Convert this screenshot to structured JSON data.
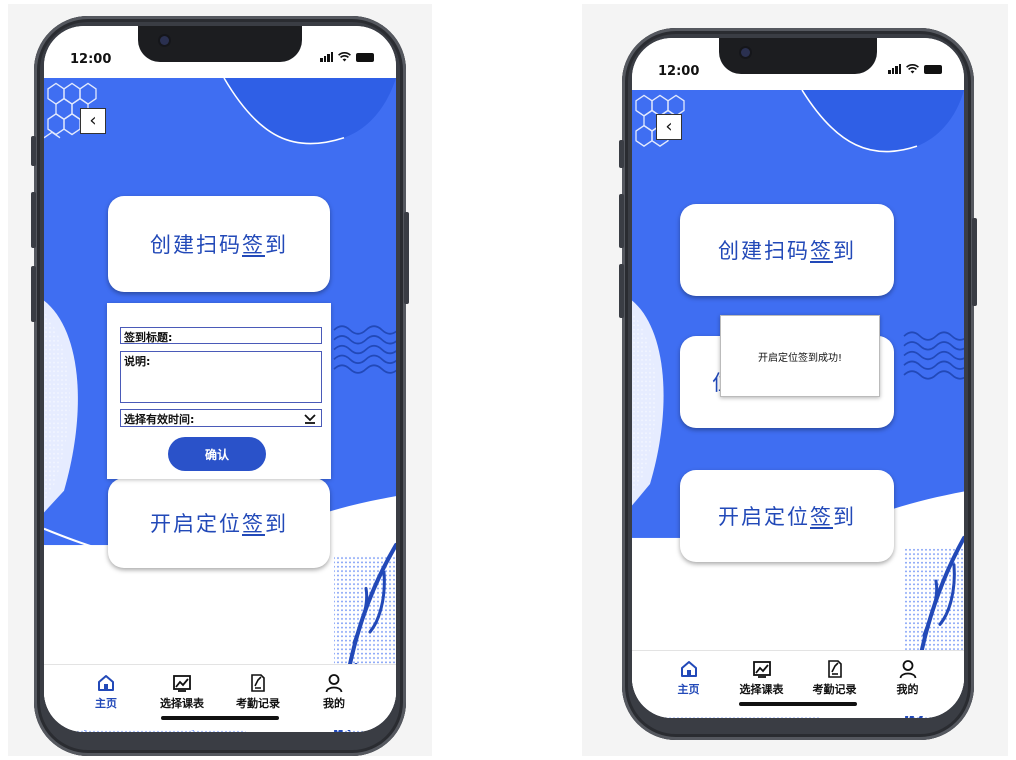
{
  "colors": {
    "accent": "#2249b8",
    "background_blue": "#3f6ef2",
    "button_blue": "#2a52c9"
  },
  "status_bar": {
    "time": "12:00"
  },
  "cards": {
    "create_qr_signin": "创建扫码签到",
    "create_qr_signin_prefix": "创建扫码",
    "location_signin_prefix": "开启定位",
    "signin_suffix_a": "签",
    "signin_suffix_b": "到"
  },
  "form": {
    "title_label": "签到标题:",
    "desc_label": "说明:",
    "time_label": "选择有效时间:",
    "confirm_label": "确认"
  },
  "toast": {
    "message": "开启定位签到成功!"
  },
  "card_partial_text": "位",
  "tabs": [
    {
      "label": "主页",
      "icon": "home-icon",
      "active": true
    },
    {
      "label": "选择课表",
      "icon": "schedule-icon",
      "active": false
    },
    {
      "label": "考勤记录",
      "icon": "record-icon",
      "active": false
    },
    {
      "label": "我的",
      "icon": "user-icon",
      "active": false
    }
  ]
}
